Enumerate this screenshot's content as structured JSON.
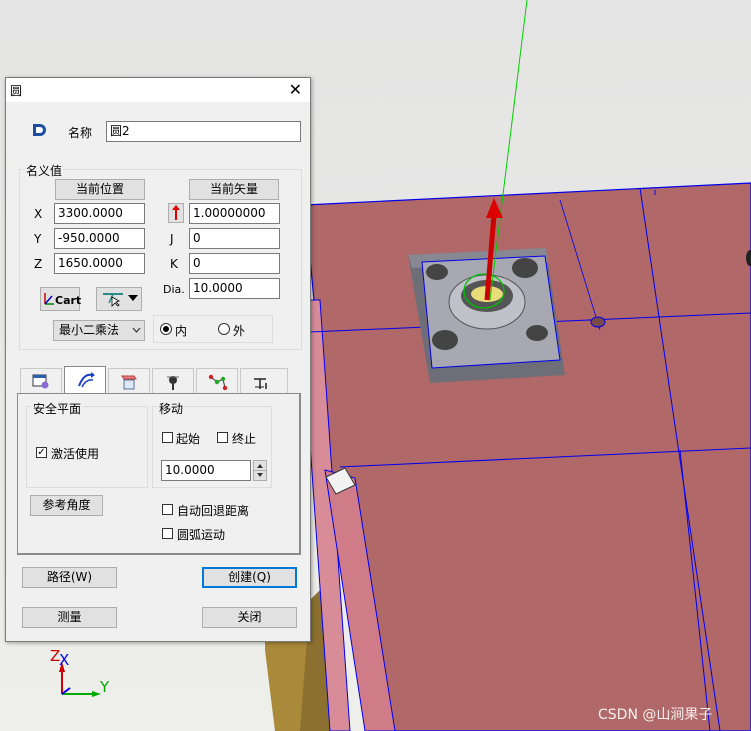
{
  "dialog": {
    "title": "圆",
    "close_glyph": "✕",
    "name_label": "名称",
    "name_value": "圆2",
    "nominal_label": "名义值",
    "current_position_button": "当前位置",
    "current_vector_button": "当前矢量",
    "x_label": "X",
    "x_value": "3300.0000",
    "y_label": "Y",
    "y_value": "-950.0000",
    "z_label": "Z",
    "z_value": "1650.0000",
    "i_value": "1.00000000",
    "j_label": "J",
    "j_value": "0",
    "k_label": "K",
    "k_value": "0",
    "dia_label": "Dia.",
    "dia_value": "10.0000",
    "cart_label": "Cart",
    "fit_method": "最小二乘法",
    "inner_label": "内",
    "outer_label": "外",
    "safe_plane_label": "安全平面",
    "activate_label": "激活使用",
    "move_label": "移动",
    "start_label": "起始",
    "end_label": "终止",
    "move_value": "10.0000",
    "ref_angle_button": "参考角度",
    "auto_retract_label": "自动回退距离",
    "arc_move_label": "圆弧运动",
    "path_button": "路径(W)",
    "create_button": "创建(Q)",
    "measure_button": "测量",
    "close_button": "关闭"
  },
  "axes": {
    "z": "Z",
    "x": "X",
    "y": "Y"
  },
  "watermark": "CSDN @山涧果子",
  "colors": {
    "accent": "#0078d7",
    "part": "#b06868",
    "background": "#e6e6e6"
  }
}
